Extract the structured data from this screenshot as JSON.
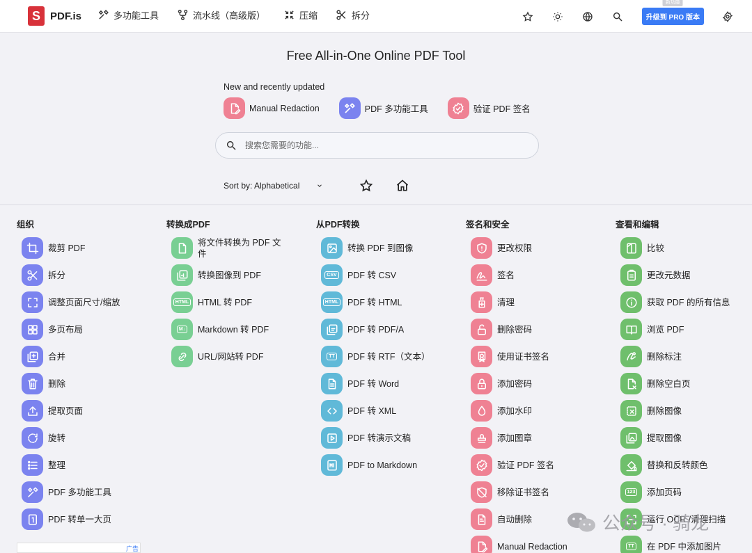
{
  "brand": {
    "name": "PDF.is",
    "logo_letter": "S"
  },
  "nav": [
    {
      "label": "多功能工具",
      "icon": "tools-icon"
    },
    {
      "label": "流水线（高级版）",
      "icon": "pipeline-icon"
    },
    {
      "label": "压缩",
      "icon": "compress-icon"
    },
    {
      "label": "拆分",
      "icon": "scissors-icon"
    }
  ],
  "top_actions": {
    "pro_label": "升级到 PRO 版本",
    "pro_badge": "新功能"
  },
  "hero": {
    "title": "Free All-in-One Online PDF Tool"
  },
  "recent": {
    "label": "New and recently updated",
    "items": [
      {
        "label": "Manual Redaction",
        "color": "red"
      },
      {
        "label": "PDF 多功能工具",
        "color": "blue"
      },
      {
        "label": "验证 PDF 签名",
        "color": "red"
      }
    ]
  },
  "search": {
    "placeholder": "搜索您需要的功能..."
  },
  "sort": {
    "label": "Sort by: Alphabetical"
  },
  "columns": [
    {
      "title": "组织",
      "color": "blue",
      "tools": [
        {
          "label": "裁剪 PDF",
          "icon": "crop-icon"
        },
        {
          "label": "拆分",
          "icon": "scissors-icon"
        },
        {
          "label": "调整页面尺寸/缩放",
          "icon": "fullscreen-icon"
        },
        {
          "label": "多页布局",
          "icon": "grid-icon"
        },
        {
          "label": "合并",
          "icon": "merge-icon"
        },
        {
          "label": "删除",
          "icon": "trash-icon"
        },
        {
          "label": "提取页面",
          "icon": "upload-icon"
        },
        {
          "label": "旋转",
          "icon": "rotate-icon"
        },
        {
          "label": "整理",
          "icon": "list-icon"
        },
        {
          "label": "PDF 多功能工具",
          "icon": "tools-icon"
        },
        {
          "label": "PDF 转单一大页",
          "icon": "single-page-icon"
        }
      ]
    },
    {
      "title": "转换成PDF",
      "color": "green",
      "tools": [
        {
          "label": "将文件转换为 PDF 文件",
          "icon": "file-icon"
        },
        {
          "label": "转换图像到 PDF",
          "icon": "image-pdf-icon"
        },
        {
          "label": "HTML 转 PDF",
          "icon": "html-icon",
          "text": "HTML"
        },
        {
          "label": "Markdown 转 PDF",
          "icon": "markdown-icon",
          "text": "M↓"
        },
        {
          "label": "URL/网站转 PDF",
          "icon": "link-icon"
        }
      ]
    },
    {
      "title": "从PDF转换",
      "color": "teal",
      "tools": [
        {
          "label": "转换 PDF 到图像",
          "icon": "image-icon"
        },
        {
          "label": "PDF 转 CSV",
          "icon": "csv-icon",
          "text": "CSV"
        },
        {
          "label": "PDF 转 HTML",
          "icon": "html-icon",
          "text": "HTML"
        },
        {
          "label": "PDF 转 PDF/A",
          "icon": "pdfa-icon"
        },
        {
          "label": "PDF 转 RTF（文本）",
          "icon": "text-icon",
          "text": "TT"
        },
        {
          "label": "PDF 转 Word",
          "icon": "document-icon"
        },
        {
          "label": "PDF 转 XML",
          "icon": "code-icon"
        },
        {
          "label": "PDF 转演示文稿",
          "icon": "slides-icon"
        },
        {
          "label": "PDF to Markdown",
          "icon": "markdown-icon"
        }
      ]
    },
    {
      "title": "签名和安全",
      "color": "red",
      "tools": [
        {
          "label": "更改权限",
          "icon": "shield-icon"
        },
        {
          "label": "签名",
          "icon": "signature-icon"
        },
        {
          "label": "清理",
          "icon": "sanitize-icon"
        },
        {
          "label": "删除密码",
          "icon": "unlock-icon"
        },
        {
          "label": "使用证书签名",
          "icon": "certificate-icon"
        },
        {
          "label": "添加密码",
          "icon": "lock-icon"
        },
        {
          "label": "添加水印",
          "icon": "droplet-icon"
        },
        {
          "label": "添加图章",
          "icon": "stamp-icon"
        },
        {
          "label": "验证 PDF 签名",
          "icon": "verified-icon"
        },
        {
          "label": "移除证书签名",
          "icon": "remove-cert-icon"
        },
        {
          "label": "自动删除",
          "icon": "auto-redact-icon"
        },
        {
          "label": "Manual Redaction",
          "icon": "redact-icon"
        }
      ]
    },
    {
      "title": "查看和编辑",
      "color": "lime",
      "tools": [
        {
          "label": "比较",
          "icon": "compare-icon"
        },
        {
          "label": "更改元数据",
          "icon": "clipboard-icon"
        },
        {
          "label": "获取 PDF 的所有信息",
          "icon": "info-icon"
        },
        {
          "label": "浏览 PDF",
          "icon": "book-icon"
        },
        {
          "label": "删除标注",
          "icon": "annotation-icon"
        },
        {
          "label": "删除空白页",
          "icon": "blank-page-icon"
        },
        {
          "label": "删除图像",
          "icon": "remove-image-icon"
        },
        {
          "label": "提取图像",
          "icon": "extract-image-icon"
        },
        {
          "label": "替换和反转颜色",
          "icon": "paint-icon"
        },
        {
          "label": "添加页码",
          "icon": "numbers-icon",
          "text": "123"
        },
        {
          "label": "运行 OCR /清理扫描",
          "icon": "ocr-icon"
        },
        {
          "label": "在 PDF 中添加图片",
          "icon": "add-image-icon",
          "text": "TT"
        }
      ]
    }
  ],
  "ad": {
    "tag": "广告"
  },
  "watermark": {
    "text": "公众号 · 骑龙"
  }
}
